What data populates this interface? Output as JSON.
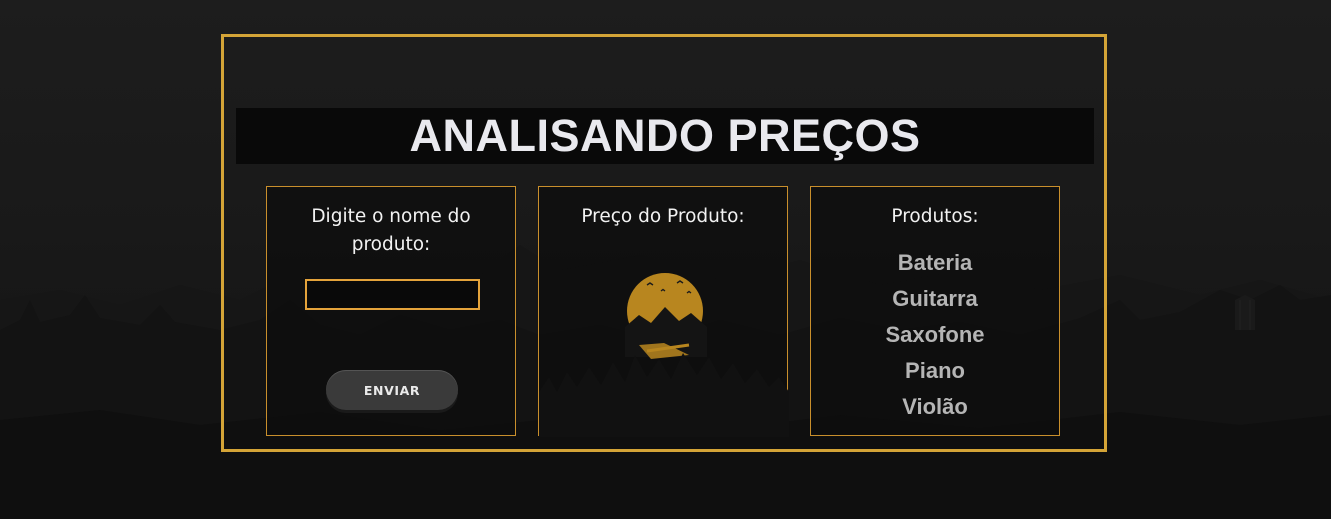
{
  "header": {
    "title": "ANALISANDO PREÇOS"
  },
  "input_panel": {
    "heading": "Digite o nome do produto:",
    "input_value": "",
    "input_placeholder": "",
    "submit_label": "ENVIAR"
  },
  "price_panel": {
    "heading": "Preço do Produto:",
    "result": ""
  },
  "products_panel": {
    "heading": "Produtos:",
    "items": [
      "Bateria",
      "Guitarra",
      "Saxofone",
      "Piano",
      "Violão"
    ]
  },
  "colors": {
    "accent": "#d4a437",
    "panel_border": "#c98f2c",
    "input_border": "#e4a33b",
    "moon": "#b8861f",
    "background": "#181818"
  }
}
